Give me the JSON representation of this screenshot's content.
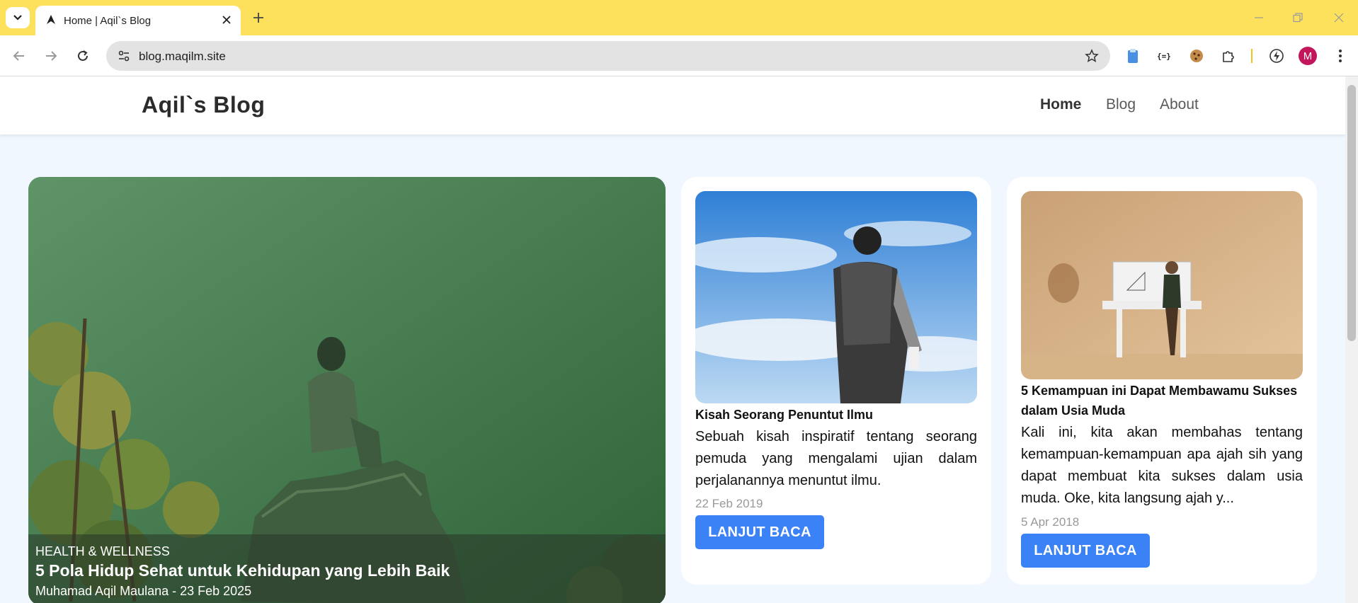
{
  "browser": {
    "tab_title": "Home | Aqil`s Blog",
    "url": "blog.maqilm.site",
    "profile_initial": "M"
  },
  "site": {
    "brand": "Aqil`s Blog",
    "nav": [
      {
        "label": "Home",
        "active": true
      },
      {
        "label": "Blog",
        "active": false
      },
      {
        "label": "About",
        "active": false
      }
    ]
  },
  "featured": {
    "category": "HEALTH & WELLNESS",
    "title": "5 Pola Hidup Sehat untuk Kehidupan yang Lebih Baik",
    "meta": "Muhamad Aqil Maulana - 23 Feb 2025"
  },
  "posts": [
    {
      "title": "Kisah Seorang Penuntut Ilmu",
      "excerpt": "Sebuah kisah inspiratif tentang seorang pemuda yang mengalami ujian dalam perjalanannya menuntut ilmu.",
      "date": "22 Feb 2019",
      "button": "LANJUT BACA"
    },
    {
      "title": "5 Kemampuan ini Dapat Membawamu Sukses dalam Usia Muda",
      "excerpt": "Kali ini, kita akan membahas tentang kemampuan-kemampuan apa ajah sih yang dapat membuat kita sukses dalam usia muda. Oke, kita langsung ajah y...",
      "date": "5 Apr 2018",
      "button": "LANJUT BACA"
    }
  ],
  "colors": {
    "tabstrip": "#fde15c",
    "accent": "#3b82f6",
    "page_bg": "#f1f7ff"
  }
}
